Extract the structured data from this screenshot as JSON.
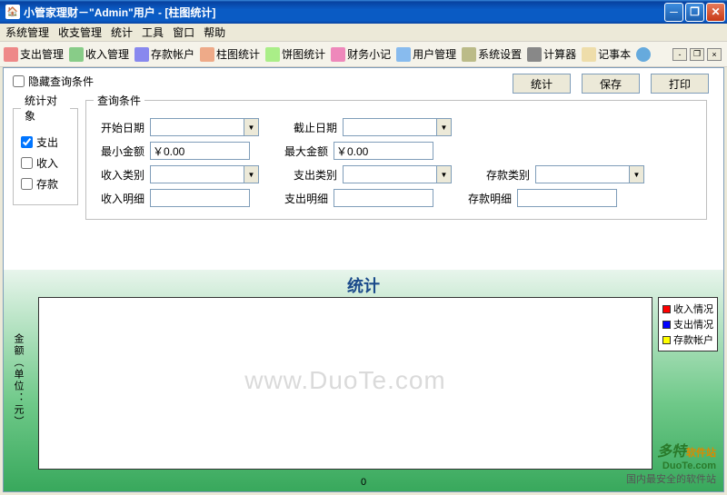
{
  "titlebar": {
    "title": "小管家理财－\"Admin\"用户 - [柱图统计]"
  },
  "menu": {
    "system": "系统管理",
    "income_expense": "收支管理",
    "stats": "统计",
    "tools": "工具",
    "window": "窗口",
    "help": "帮助"
  },
  "toolbar": {
    "expense_mgmt": "支出管理",
    "income_mgmt": "收入管理",
    "deposit_acct": "存款帐户",
    "bar_stats": "柱图统计",
    "pie_stats": "饼图统计",
    "finance_note": "财务小记",
    "user_mgmt": "用户管理",
    "sys_settings": "系统设置",
    "calculator": "计算器",
    "notepad": "记事本"
  },
  "form": {
    "hide_cond": "隐藏查询条件",
    "stat_target_legend": "统计对象",
    "expense": "支出",
    "income": "收入",
    "deposit": "存款",
    "query_legend": "查询条件",
    "start_date": "开始日期",
    "end_date": "截止日期",
    "min_amount": "最小金额",
    "max_amount": "最大金额",
    "min_amount_val": "￥0.00",
    "max_amount_val": "￥0.00",
    "income_cat": "收入类别",
    "expense_cat": "支出类别",
    "deposit_cat": "存款类别",
    "income_detail": "收入明细",
    "expense_detail": "支出明细",
    "deposit_detail": "存款明细"
  },
  "buttons": {
    "stats": "统计",
    "save": "保存",
    "print": "打印"
  },
  "chart_data": {
    "type": "bar",
    "title": "统计",
    "xlabel": "0",
    "ylabel": "金额（单位：元）",
    "categories": [],
    "series": [
      {
        "name": "收入情况",
        "color": "#ff0000",
        "values": []
      },
      {
        "name": "支出情况",
        "color": "#0000ff",
        "values": []
      },
      {
        "name": "存款帐户",
        "color": "#ffff00",
        "values": []
      }
    ],
    "ylim": [
      0,
      0
    ]
  },
  "watermark": "www.DuoTe.com",
  "branding": {
    "name": "多特",
    "suffix": "软件站",
    "url": "DuoTe.com",
    "slogan": "国内最安全的软件站"
  }
}
